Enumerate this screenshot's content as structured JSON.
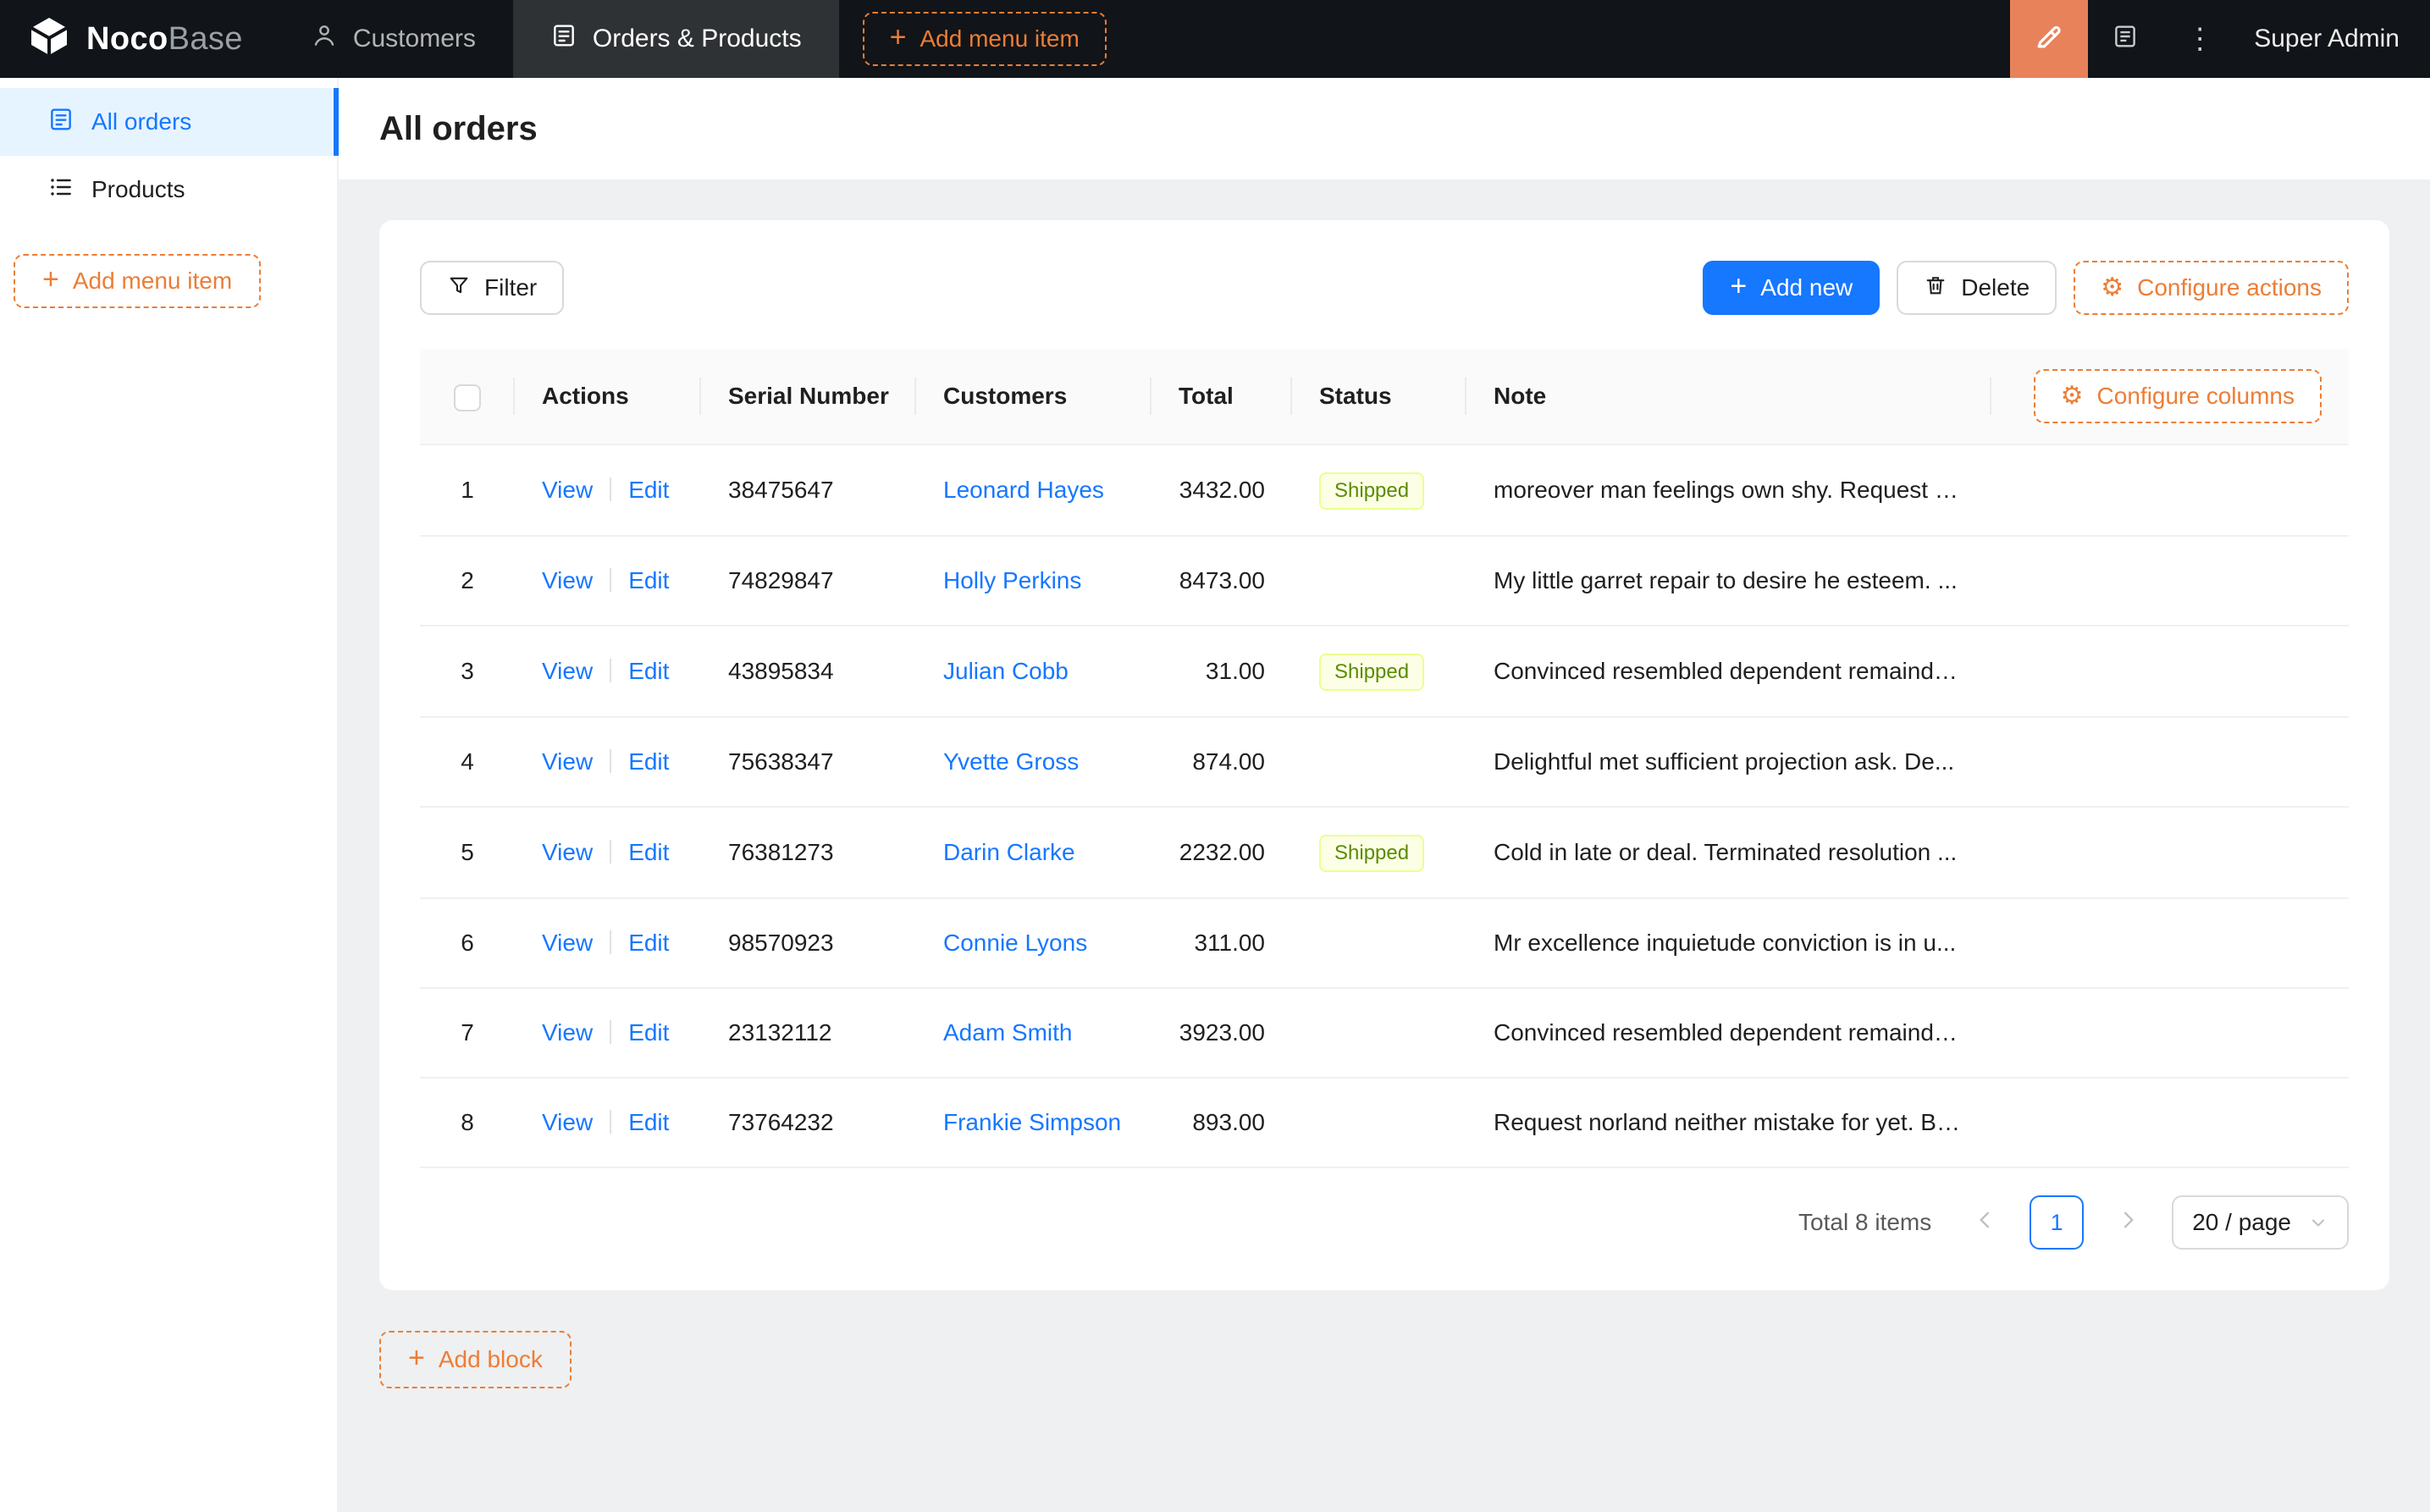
{
  "colors": {
    "navbar_bg": "#111418",
    "accent_orange": "#ED7D35",
    "editor_button_bg": "#E8825B",
    "primary_blue": "#1677ff",
    "sidebar_selected_bg": "#e6f4ff",
    "content_bg": "#eef0f2",
    "tag_shipped_bg": "#fcffe6",
    "tag_shipped_border": "#eaff8f",
    "tag_shipped_text": "#5b8c00"
  },
  "glyphs": {
    "plus": "+",
    "gear": "⚙",
    "more": "⋮"
  },
  "navbar": {
    "logo": {
      "primary": "Noco",
      "secondary": "Base"
    },
    "menu_items": [
      {
        "label": "Customers",
        "icon": "users-icon",
        "active": false
      },
      {
        "label": "Orders & Products",
        "icon": "form-icon",
        "active": true
      }
    ],
    "add_menu_item_label": "Add menu item",
    "user_label": "Super Admin",
    "icons": [
      "highlighter-icon",
      "book-icon",
      "more-vertical-icon"
    ]
  },
  "sidebar": {
    "items": [
      {
        "label": "All orders",
        "icon": "orders-icon",
        "active": true
      },
      {
        "label": "Products",
        "icon": "unordered-list-icon",
        "active": false
      }
    ],
    "add_menu_item_label": "Add menu item"
  },
  "page": {
    "title": "All orders"
  },
  "toolbar": {
    "filter_label": "Filter",
    "add_new_label": "Add new",
    "delete_label": "Delete",
    "configure_actions_label": "Configure actions"
  },
  "table": {
    "configure_columns_label": "Configure columns",
    "columns": [
      "Actions",
      "Serial Number",
      "Customers",
      "Total",
      "Status",
      "Note"
    ],
    "action_links": {
      "view": "View",
      "edit": "Edit"
    },
    "rows": [
      {
        "index": "1",
        "serial": "38475647",
        "customer": "Leonard Hayes",
        "total": "3432.00",
        "status": "Shipped",
        "note": "moreover man feelings own shy. Request n..."
      },
      {
        "index": "2",
        "serial": "74829847",
        "customer": "Holly Perkins",
        "total": "8473.00",
        "status": "",
        "note": "My little garret repair to desire he esteem. ..."
      },
      {
        "index": "3",
        "serial": "43895834",
        "customer": "Julian Cobb",
        "total": "31.00",
        "status": "Shipped",
        "note": "Convinced resembled dependent remainde..."
      },
      {
        "index": "4",
        "serial": "75638347",
        "customer": "Yvette Gross",
        "total": "874.00",
        "status": "",
        "note": "Delightful met sufficient projection ask. De..."
      },
      {
        "index": "5",
        "serial": "76381273",
        "customer": "Darin Clarke",
        "total": "2232.00",
        "status": "Shipped",
        "note": "Cold in late or deal. Terminated resolution ..."
      },
      {
        "index": "6",
        "serial": "98570923",
        "customer": "Connie Lyons",
        "total": "311.00",
        "status": "",
        "note": "Mr excellence inquietude conviction is in u..."
      },
      {
        "index": "7",
        "serial": "23132112",
        "customer": "Adam Smith",
        "total": "3923.00",
        "status": "",
        "note": "Convinced resembled dependent remainde..."
      },
      {
        "index": "8",
        "serial": "73764232",
        "customer": "Frankie Simpson",
        "total": "893.00",
        "status": "",
        "note": "Request norland neither mistake for yet. Be..."
      }
    ]
  },
  "pagination": {
    "total_text": "Total 8 items",
    "current_page": "1",
    "page_size_label": "20 / page"
  },
  "footer": {
    "add_block_label": "Add block"
  }
}
